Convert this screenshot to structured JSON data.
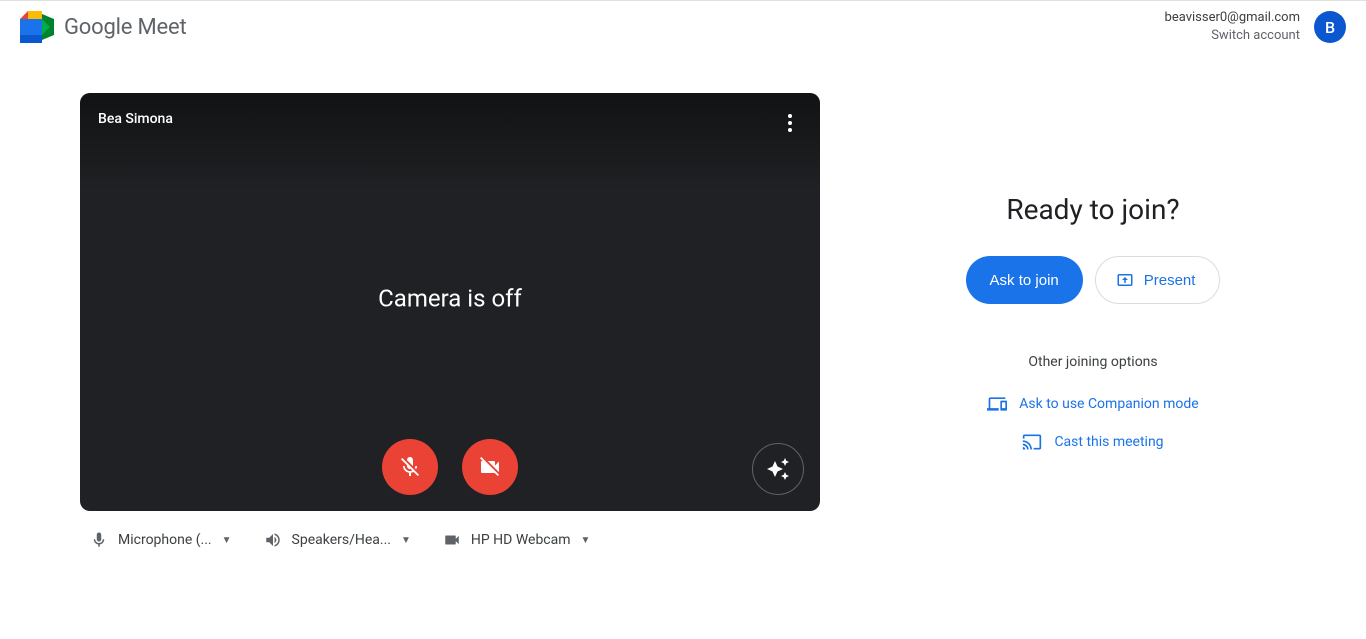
{
  "header": {
    "brand_strong": "Google",
    "brand_light": "Meet",
    "email": "beavisser0@gmail.com",
    "switch_account": "Switch account",
    "avatar_initial": "B"
  },
  "preview": {
    "participant_name": "Bea Simona",
    "camera_status": "Camera is off"
  },
  "devices": {
    "mic": "Microphone (...",
    "speaker": "Speakers/Hea...",
    "camera": "HP HD Webcam"
  },
  "join": {
    "title": "Ready to join?",
    "ask_button": "Ask to join",
    "present_button": "Present",
    "other_options_label": "Other joining options",
    "companion": "Ask to use Companion mode",
    "cast": "Cast this meeting"
  }
}
